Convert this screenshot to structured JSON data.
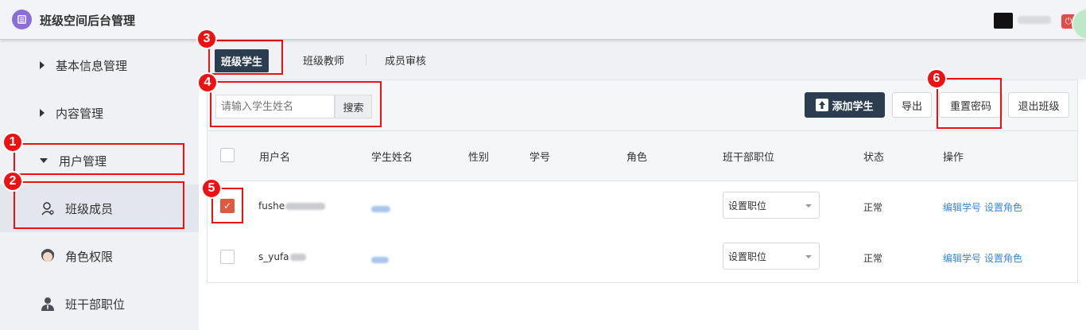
{
  "app": {
    "title": "班级空间后台管理"
  },
  "header": {
    "power_icon": "power-icon"
  },
  "sidebar": {
    "items": [
      {
        "label": "基本信息管理",
        "icon": "caret-right-icon"
      },
      {
        "label": "内容管理",
        "icon": "caret-right-icon"
      },
      {
        "label": "用户管理",
        "icon": "caret-down-icon"
      }
    ],
    "sub_items": [
      {
        "label": "班级成员",
        "icon": "person-icon",
        "active": true
      },
      {
        "label": "角色权限",
        "icon": "role-icon"
      },
      {
        "label": "班干部职位",
        "icon": "officer-icon"
      }
    ]
  },
  "tabs": [
    {
      "label": "班级学生",
      "active": true
    },
    {
      "label": "班级教师"
    },
    {
      "label": "成员审核"
    }
  ],
  "toolbar": {
    "search_placeholder": "请输入学生姓名",
    "search_label": "搜索",
    "add_label": "添加学生",
    "export_label": "导出",
    "reset_password_label": "重置密码",
    "leave_class_label": "退出班级"
  },
  "table": {
    "columns": [
      "用户名",
      "学生姓名",
      "性别",
      "学号",
      "角色",
      "班干部职位",
      "状态",
      "操作"
    ],
    "rows": [
      {
        "username": "fushe",
        "status": "正常",
        "position": "设置职位",
        "checked": true,
        "action1": "编辑学号",
        "action2": "设置角色"
      },
      {
        "username": "s_yufa",
        "status": "正常",
        "position": "设置职位",
        "checked": false,
        "action1": "编辑学号",
        "action2": "设置角色"
      }
    ]
  },
  "annotations": [
    "1",
    "2",
    "3",
    "4",
    "5",
    "6"
  ],
  "colors": {
    "accent_dark": "#2b3d4f",
    "annotation_red": "#ee1111",
    "link_blue": "#3a87d6",
    "check_red": "#e0583e"
  }
}
